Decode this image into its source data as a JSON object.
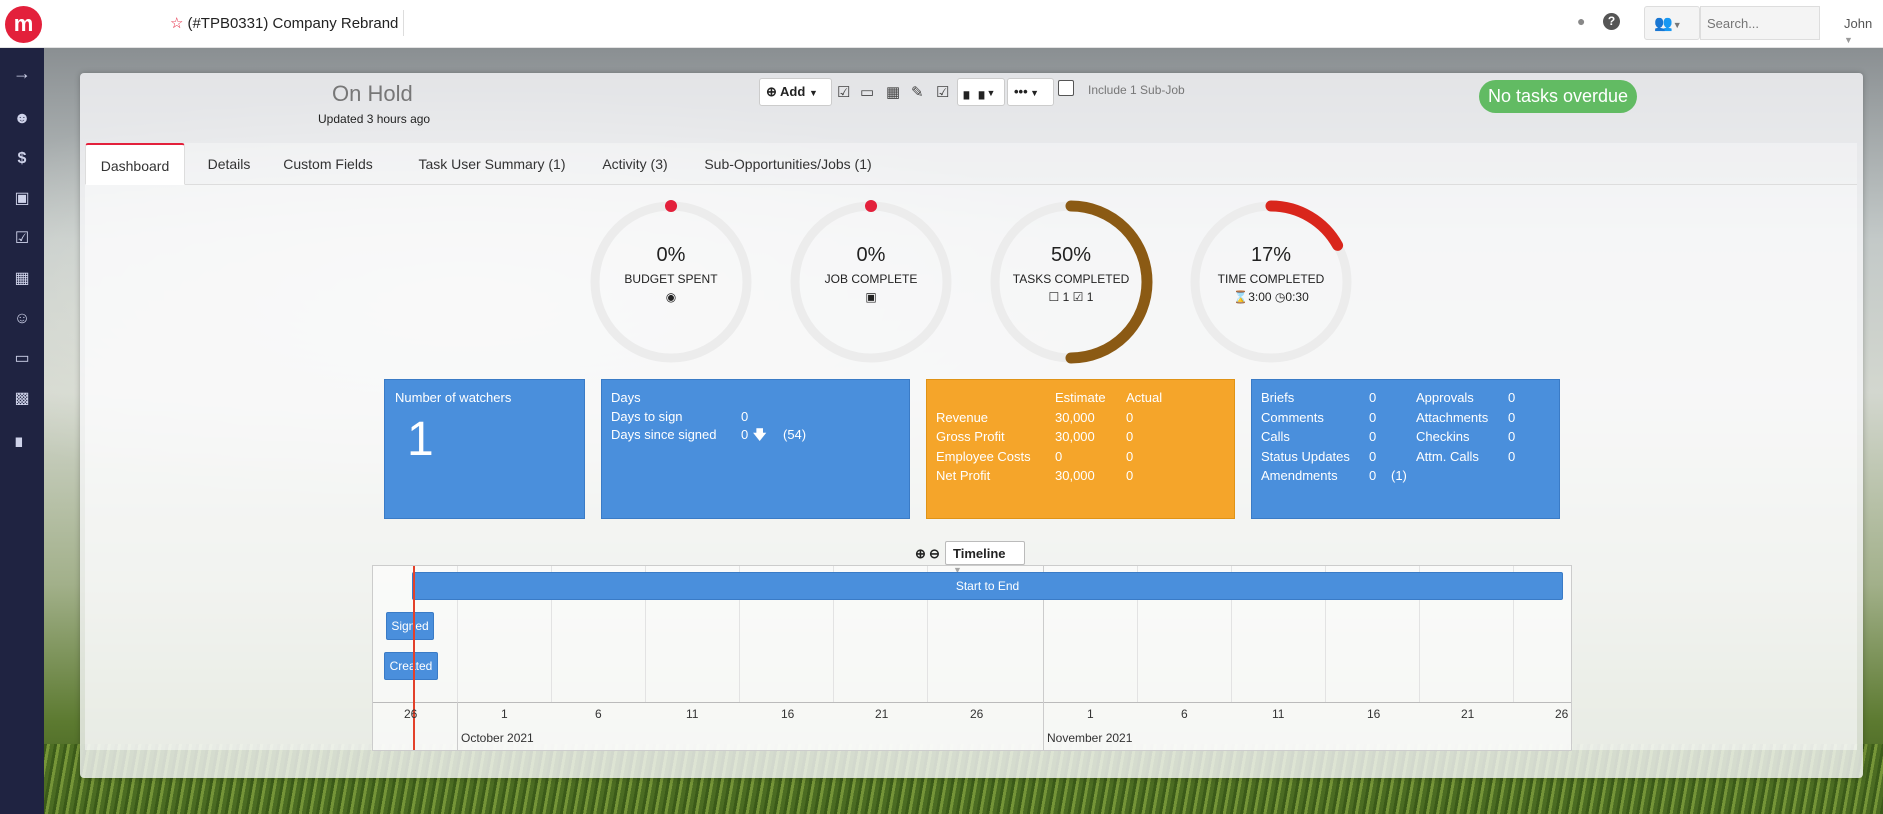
{
  "header": {
    "logo": "m",
    "star": "☆",
    "job_title": "(#TPB0331) Company Rebrand",
    "search_placeholder": "Search...",
    "user_name": "John"
  },
  "status": {
    "title": "On Hold",
    "updated": "Updated 3 hours ago",
    "overdue_badge": "No tasks overdue"
  },
  "toolbar": {
    "add_label": "Add",
    "more_label": "•••",
    "include_sub_job_label": "Include 1 Sub-Job"
  },
  "tabs": [
    {
      "label": "Dashboard",
      "active": true
    },
    {
      "label": "Details"
    },
    {
      "label": "Custom Fields"
    },
    {
      "label": "Task User Summary (1)"
    },
    {
      "label": "Activity (3)"
    },
    {
      "label": "Sub-Opportunities/Jobs (1)"
    }
  ],
  "donuts": [
    {
      "percent": "0%",
      "label": "BUDGET SPENT",
      "fraction": 0,
      "color": "#e3203b"
    },
    {
      "percent": "0%",
      "label": "JOB COMPLETE",
      "fraction": 0,
      "color": "#e3203b"
    },
    {
      "percent": "50%",
      "label": "TASKS COMPLETED",
      "fraction": 0.5,
      "color": "#8b5a14",
      "open_tasks": "1",
      "done_tasks": "1"
    },
    {
      "percent": "17%",
      "label": "TIME COMPLETED",
      "fraction": 0.17,
      "color": "#d9261c",
      "time_estimate": "3:00",
      "time_spent": "0:30"
    }
  ],
  "watchers": {
    "title": "Number of watchers",
    "count": "1"
  },
  "days": {
    "title": "Days",
    "rows": [
      {
        "label": "Days to sign",
        "value": "0"
      },
      {
        "label": "Days since signed",
        "value": "0",
        "extra": "(54)"
      }
    ]
  },
  "financials": {
    "col_estimate": "Estimate",
    "col_actual": "Actual",
    "rows": [
      {
        "label": "Revenue",
        "estimate": "30,000",
        "actual": "0"
      },
      {
        "label": "Gross Profit",
        "estimate": "30,000",
        "actual": "0"
      },
      {
        "label": "Employee Costs",
        "estimate": "0",
        "actual": "0"
      },
      {
        "label": "Net Profit",
        "estimate": "30,000",
        "actual": "0"
      }
    ]
  },
  "counts": {
    "left": [
      {
        "label": "Briefs",
        "value": "0"
      },
      {
        "label": "Comments",
        "value": "0"
      },
      {
        "label": "Calls",
        "value": "0"
      },
      {
        "label": "Status Updates",
        "value": "0"
      },
      {
        "label": "Amendments",
        "value": "0",
        "extra": "(1)"
      }
    ],
    "right": [
      {
        "label": "Approvals",
        "value": "0"
      },
      {
        "label": "Attachments",
        "value": "0"
      },
      {
        "label": "Checkins",
        "value": "0"
      },
      {
        "label": "Attm. Calls",
        "value": "0"
      }
    ]
  },
  "timeline": {
    "view_label": "Timeline",
    "bars": {
      "start_to_end": "Start to End",
      "signed": "Signed",
      "created": "Created"
    },
    "ticks": [
      "26",
      "1",
      "6",
      "11",
      "16",
      "21",
      "26",
      "1",
      "6",
      "11",
      "16",
      "21",
      "26"
    ],
    "months": [
      "October 2021",
      "November 2021"
    ]
  }
}
